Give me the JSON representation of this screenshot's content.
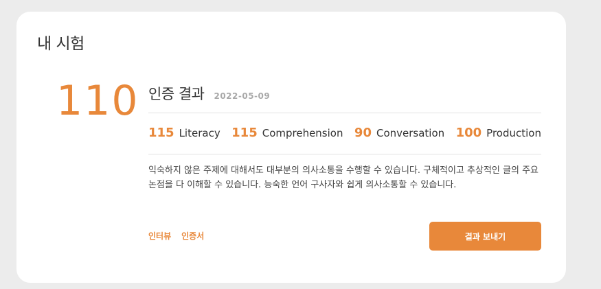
{
  "card": {
    "title": "내 시험"
  },
  "result": {
    "overall_score": "110",
    "title": "인증 결과",
    "date": "2022-05-09",
    "subscores": [
      {
        "value": "115",
        "label": "Literacy"
      },
      {
        "value": "115",
        "label": "Comprehension"
      },
      {
        "value": "90",
        "label": "Conversation"
      },
      {
        "value": "100",
        "label": "Production"
      }
    ],
    "description": "익숙하지 않은 주제에 대해서도 대부분의 의사소통을 수행할 수 있습니다. 구체적이고 추상적인 글의 주요 논점을 다 이해할 수 있습니다. 능숙한 언어 구사자와 쉽게 의사소통할 수 있습니다."
  },
  "links": {
    "interview": "인터뷰",
    "certificate": "인증서"
  },
  "actions": {
    "send_result": "결과 보내기"
  },
  "colors": {
    "accent": "#e8883a",
    "background": "#ececec",
    "card": "#ffffff"
  }
}
